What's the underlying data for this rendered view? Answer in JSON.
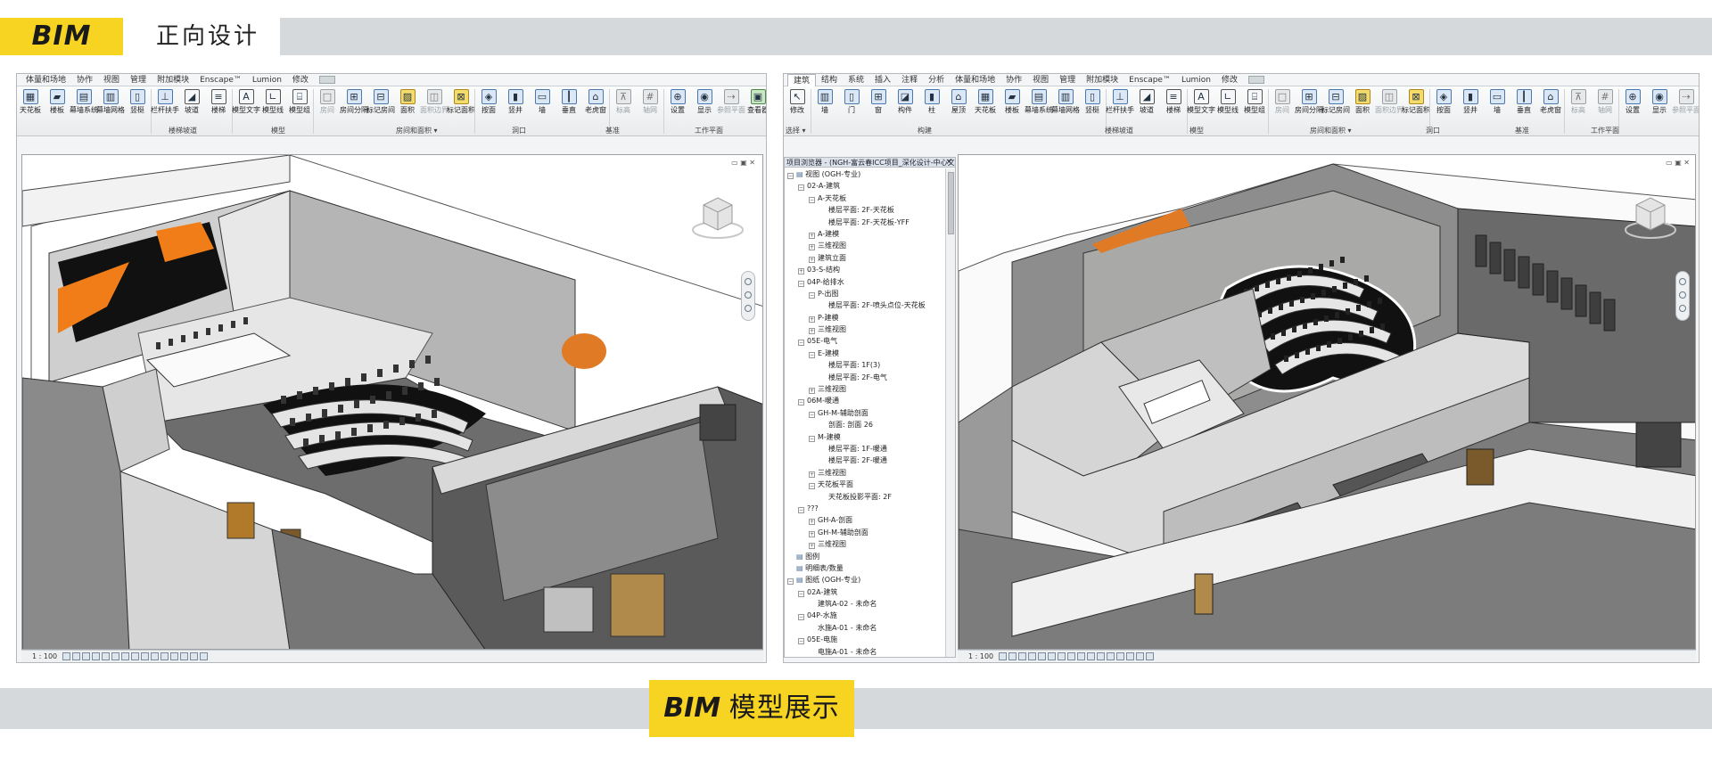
{
  "header": {
    "badge": "BIM",
    "title": "正向设计"
  },
  "footer": {
    "badge_bim": "BIM",
    "badge_rest": "模型展示"
  },
  "left_window": {
    "tabs": [
      "体量和场地",
      "协作",
      "视图",
      "管理",
      "附加模块",
      "Enscape™",
      "Lumion",
      "修改"
    ],
    "ribbon": [
      {
        "label": "天花板",
        "icon": "ceiling-icon",
        "style": "b"
      },
      {
        "label": "楼板",
        "icon": "floor-icon",
        "style": "b"
      },
      {
        "label": "幕墙系统",
        "icon": "curtain-system-icon",
        "style": "b"
      },
      {
        "label": "幕墙网格",
        "icon": "curtain-grid-icon",
        "style": "b"
      },
      {
        "label": "竖梃",
        "icon": "mullion-icon",
        "style": "b"
      },
      {
        "label": "栏杆扶手",
        "icon": "railing-icon",
        "style": "b"
      },
      {
        "label": "坡道",
        "icon": "ramp-icon",
        "style": "k"
      },
      {
        "label": "楼梯",
        "icon": "stair-icon",
        "style": "k"
      },
      {
        "label": "模型文字",
        "icon": "model-text-icon",
        "style": "k"
      },
      {
        "label": "模型线",
        "icon": "model-line-icon",
        "style": "k"
      },
      {
        "label": "模型组",
        "icon": "model-group-icon",
        "style": "k"
      },
      {
        "label": "房间",
        "icon": "room-icon",
        "style": "g"
      },
      {
        "label": "房间分隔",
        "icon": "room-separator-icon",
        "style": "b"
      },
      {
        "label": "标记房间",
        "icon": "tag-room-icon",
        "style": "b"
      },
      {
        "label": "面积",
        "icon": "area-icon",
        "style": "y"
      },
      {
        "label": "面积边界",
        "icon": "area-boundary-icon",
        "style": "g"
      },
      {
        "label": "标记面积",
        "icon": "tag-area-icon",
        "style": "y"
      },
      {
        "label": "按面",
        "icon": "by-face-icon",
        "style": "b"
      },
      {
        "label": "竖井",
        "icon": "shaft-icon",
        "style": "b"
      },
      {
        "label": "墙",
        "icon": "wall-opening-icon",
        "style": "b"
      },
      {
        "label": "垂直",
        "icon": "vertical-icon",
        "style": "b"
      },
      {
        "label": "老虎窗",
        "icon": "dormer-icon",
        "style": "b"
      },
      {
        "label": "标高",
        "icon": "level-icon",
        "style": "g"
      },
      {
        "label": "轴网",
        "icon": "grid-icon",
        "style": "g"
      },
      {
        "label": "设置",
        "icon": "set-icon",
        "style": "b"
      },
      {
        "label": "显示",
        "icon": "show-icon",
        "style": "b"
      },
      {
        "label": "参照平面",
        "icon": "ref-plane-icon",
        "style": "g"
      },
      {
        "label": "查看器",
        "icon": "viewer-icon",
        "style": "grn"
      }
    ],
    "panels": [
      "楼梯坡道",
      "模型",
      "房间和面积 ▾",
      "洞口",
      "基准",
      "工作平面"
    ],
    "scale": "1 : 100"
  },
  "right_window": {
    "tabs": [
      "建筑",
      "结构",
      "系统",
      "插入",
      "注释",
      "分析",
      "体量和场地",
      "协作",
      "视图",
      "管理",
      "附加模块",
      "Enscape™",
      "Lumion",
      "修改"
    ],
    "ribbon": [
      {
        "label": "修改",
        "icon": "modify-icon",
        "style": "k"
      },
      {
        "label": "墙",
        "icon": "wall-icon",
        "style": "b"
      },
      {
        "label": "门",
        "icon": "door-icon",
        "style": "b"
      },
      {
        "label": "窗",
        "icon": "window-icon",
        "style": "b"
      },
      {
        "label": "构件",
        "icon": "component-icon",
        "style": "b"
      },
      {
        "label": "柱",
        "icon": "column-icon",
        "style": "b"
      },
      {
        "label": "屋顶",
        "icon": "roof-icon",
        "style": "b"
      },
      {
        "label": "天花板",
        "icon": "ceiling-icon",
        "style": "b"
      },
      {
        "label": "楼板",
        "icon": "floor-icon",
        "style": "b"
      },
      {
        "label": "幕墙系统",
        "icon": "curtain-system-icon",
        "style": "b"
      },
      {
        "label": "幕墙网格",
        "icon": "curtain-grid-icon",
        "style": "b"
      },
      {
        "label": "竖梃",
        "icon": "mullion-icon",
        "style": "b"
      },
      {
        "label": "栏杆扶手",
        "icon": "railing-icon",
        "style": "b"
      },
      {
        "label": "坡道",
        "icon": "ramp-icon",
        "style": "k"
      },
      {
        "label": "楼梯",
        "icon": "stair-icon",
        "style": "k"
      },
      {
        "label": "模型文字",
        "icon": "model-text-icon",
        "style": "k"
      },
      {
        "label": "模型线",
        "icon": "model-line-icon",
        "style": "k"
      },
      {
        "label": "模型组",
        "icon": "model-group-icon",
        "style": "k"
      },
      {
        "label": "房间",
        "icon": "room-icon",
        "style": "g"
      },
      {
        "label": "房间分隔",
        "icon": "room-separator-icon",
        "style": "b"
      },
      {
        "label": "标记房间",
        "icon": "tag-room-icon",
        "style": "b"
      },
      {
        "label": "面积",
        "icon": "area-icon",
        "style": "y"
      },
      {
        "label": "面积边界",
        "icon": "area-boundary-icon",
        "style": "g"
      },
      {
        "label": "标记面积",
        "icon": "tag-area-icon",
        "style": "y"
      },
      {
        "label": "按面",
        "icon": "by-face-icon",
        "style": "b"
      },
      {
        "label": "竖井",
        "icon": "shaft-icon",
        "style": "b"
      },
      {
        "label": "墙",
        "icon": "wall-opening-icon",
        "style": "b"
      },
      {
        "label": "垂直",
        "icon": "vertical-icon",
        "style": "b"
      },
      {
        "label": "老虎窗",
        "icon": "dormer-icon",
        "style": "b"
      },
      {
        "label": "标高",
        "icon": "level-icon",
        "style": "g"
      },
      {
        "label": "轴网",
        "icon": "grid-icon",
        "style": "g"
      },
      {
        "label": "设置",
        "icon": "set-icon",
        "style": "b"
      },
      {
        "label": "显示",
        "icon": "show-icon",
        "style": "b"
      },
      {
        "label": "参照平面",
        "icon": "ref-plane-icon",
        "style": "g"
      },
      {
        "label": "查看器",
        "icon": "viewer-icon",
        "style": "grn"
      }
    ],
    "panels": [
      "选择 ▾",
      "构建",
      "楼梯坡道",
      "模型",
      "房间和面积 ▾",
      "洞口",
      "基准",
      "工作平面"
    ],
    "scale": "1 : 100",
    "browser": {
      "title": "项目浏览器 - (NGH-富云春ICC项目_深化设计-中心文...",
      "close": "×",
      "items": [
        {
          "text": "视图 (OGH-专业)",
          "level": 0,
          "toggle": "-",
          "icon": "views-icon"
        },
        {
          "text": "02-A-建筑",
          "level": 1,
          "toggle": "-"
        },
        {
          "text": "A-天花板",
          "level": 2,
          "toggle": "-"
        },
        {
          "text": "楼层平面: 2F-天花板",
          "level": 3,
          "toggle": ""
        },
        {
          "text": "楼层平面: 2F-天花板-YFF",
          "level": 3,
          "toggle": ""
        },
        {
          "text": "A-建模",
          "level": 2,
          "toggle": "+"
        },
        {
          "text": "三维视图",
          "level": 2,
          "toggle": "+"
        },
        {
          "text": "建筑立面",
          "level": 2,
          "toggle": "+"
        },
        {
          "text": "03-S-结构",
          "level": 1,
          "toggle": "+"
        },
        {
          "text": "04P-给排水",
          "level": 1,
          "toggle": "-"
        },
        {
          "text": "P-出图",
          "level": 2,
          "toggle": "-"
        },
        {
          "text": "楼层平面: 2F-喷头点位-天花板",
          "level": 3,
          "toggle": ""
        },
        {
          "text": "P-建模",
          "level": 2,
          "toggle": "+"
        },
        {
          "text": "三维视图",
          "level": 2,
          "toggle": "+"
        },
        {
          "text": "05E-电气",
          "level": 1,
          "toggle": "-"
        },
        {
          "text": "E-建模",
          "level": 2,
          "toggle": "-"
        },
        {
          "text": "楼层平面: 1F(3)",
          "level": 3,
          "toggle": ""
        },
        {
          "text": "楼层平面: 2F-电气",
          "level": 3,
          "toggle": ""
        },
        {
          "text": "三维视图",
          "level": 2,
          "toggle": "+"
        },
        {
          "text": "06M-暖通",
          "level": 1,
          "toggle": "-"
        },
        {
          "text": "GH-M-辅助剖面",
          "level": 2,
          "toggle": "-"
        },
        {
          "text": "剖面: 剖面 26",
          "level": 3,
          "toggle": ""
        },
        {
          "text": "M-建模",
          "level": 2,
          "toggle": "-"
        },
        {
          "text": "楼层平面: 1F-暖通",
          "level": 3,
          "toggle": ""
        },
        {
          "text": "楼层平面: 2F-暖通",
          "level": 3,
          "toggle": ""
        },
        {
          "text": "三维视图",
          "level": 2,
          "toggle": "+"
        },
        {
          "text": "天花板平面",
          "level": 2,
          "toggle": "-"
        },
        {
          "text": "天花板投影平面: 2F",
          "level": 3,
          "toggle": ""
        },
        {
          "text": "???",
          "level": 1,
          "toggle": "-"
        },
        {
          "text": "GH-A-剖面",
          "level": 2,
          "toggle": "+"
        },
        {
          "text": "GH-M-辅助剖面",
          "level": 2,
          "toggle": "+"
        },
        {
          "text": "三维视图",
          "level": 2,
          "toggle": "+"
        },
        {
          "text": "图例",
          "level": 0,
          "toggle": "",
          "icon": "legend-icon"
        },
        {
          "text": "明细表/数量",
          "level": 0,
          "toggle": "",
          "icon": "schedule-icon"
        },
        {
          "text": "图纸 (OGH-专业)",
          "level": 0,
          "toggle": "-",
          "icon": "sheets-icon"
        },
        {
          "text": "02A-建筑",
          "level": 1,
          "toggle": "-"
        },
        {
          "text": "建筑A-02 - 未命名",
          "level": 2,
          "toggle": ""
        },
        {
          "text": "04P-水施",
          "level": 1,
          "toggle": "-"
        },
        {
          "text": "水施A-01 - 未命名",
          "level": 2,
          "toggle": ""
        },
        {
          "text": "05E-电施",
          "level": 1,
          "toggle": "-"
        },
        {
          "text": "电施A-01 - 未命名",
          "level": 2,
          "toggle": ""
        }
      ]
    }
  },
  "colors": {
    "accent_yellow": "#f7d422",
    "band_gray": "#d5d9dc",
    "orange_panel": "#f07d18"
  }
}
